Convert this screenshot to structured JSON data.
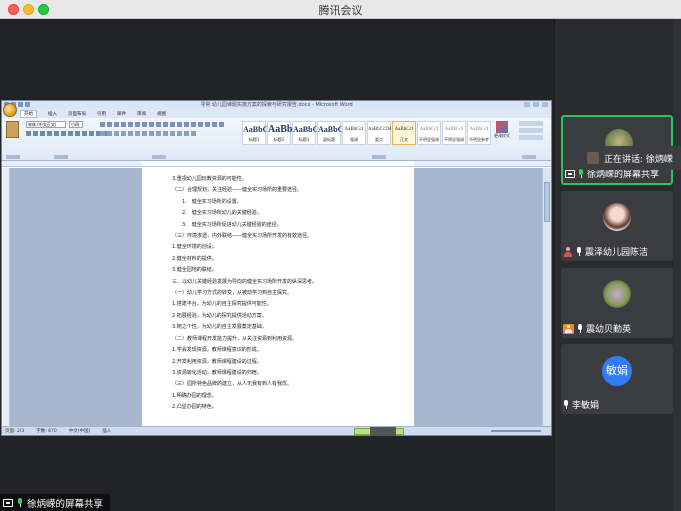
{
  "window": {
    "title": "腾讯会议"
  },
  "share": {
    "label": "徐炳嵘的屏幕共享"
  },
  "word": {
    "title": "寻常 幼儿园课题实施方案的探索与研究报告.docx - Microsoft Word",
    "tabs": [
      "开始",
      "插入",
      "页面布局",
      "引用",
      "邮件",
      "审阅",
      "视图"
    ],
    "font_name": "宋体 (中文正文)",
    "font_size": "小四",
    "styles": [
      {
        "sample": "AaBbC",
        "name": "标题1"
      },
      {
        "sample": "AaBb",
        "name": "标题2"
      },
      {
        "sample": "AaBbC",
        "name": "标题3"
      },
      {
        "sample": "AaBbC",
        "name": "副标题"
      },
      {
        "sample": "AaBbCcI",
        "name": "强调"
      },
      {
        "sample": "AaBbCcDd",
        "name": "要点"
      },
      {
        "sample": "AaBbCcI",
        "name": "正文"
      },
      {
        "sample": "AaBbCcI",
        "name": "不明显强调"
      },
      {
        "sample": "AaBbCcI",
        "name": "不明显强调"
      },
      {
        "sample": "AaBbCcI",
        "name": "不明显参考"
      }
    ],
    "change_styles": "更改样式",
    "doc_lines": [
      "3.重视幼儿园玩教资源的可能性。",
      "（二）合理规划，关注经验——健全实习场所的重要途径。",
      "1.　健全实习场所的设置。",
      "2.　健全实习场所幼儿的关键经验。",
      "3.　健全实习场所促进幼儿关键经验的途径。",
      "（三）环境渗透，内外联结——健全实习场所开发的有效途径。",
      "1.健全环境的创设。",
      "2.健全材料的提供。",
      "3.健全园地的联结。",
      "三、以幼儿关键经验发展为导向的健全实习场所开发的纵深思考。",
      "（一）幼儿学习方式的转变，从被动学习到自主探究。",
      "1.搭建平台，为幼儿的自主探究提供可能性。",
      "2.拓展经验，为幼儿的探究提供活动方案。",
      "3.随之个性，为幼儿的自主发展奠定基础。",
      "（二）教师课程开发能力提升，从关注资源到利用资源。",
      "1.学会发现资源，教师课程意识的形成。",
      "2.开发利用资源，教师课程建设的过程。",
      "3.资源转化活动，教师课程建设的归宿。",
      "（三）园所特色品牌的建立，从人无我有到人有我优。",
      "1.明确办园的理念。",
      "2.凸显办园的特色。"
    ],
    "status": [
      "页面: 2/3",
      "字数: 870",
      "中文(中国)",
      "插入"
    ]
  },
  "participants": [
    {
      "name": "徐炳嵘的屏幕共享",
      "active": true
    },
    {
      "name": "震泽幼儿园陈洁"
    },
    {
      "name": "震幼贝勤英"
    },
    {
      "name": "李敏娟",
      "avatar_text": "敏娟",
      "avatar_color": "#2f7cf6"
    }
  ],
  "speaking": "正在讲话: 徐炳嵘"
}
